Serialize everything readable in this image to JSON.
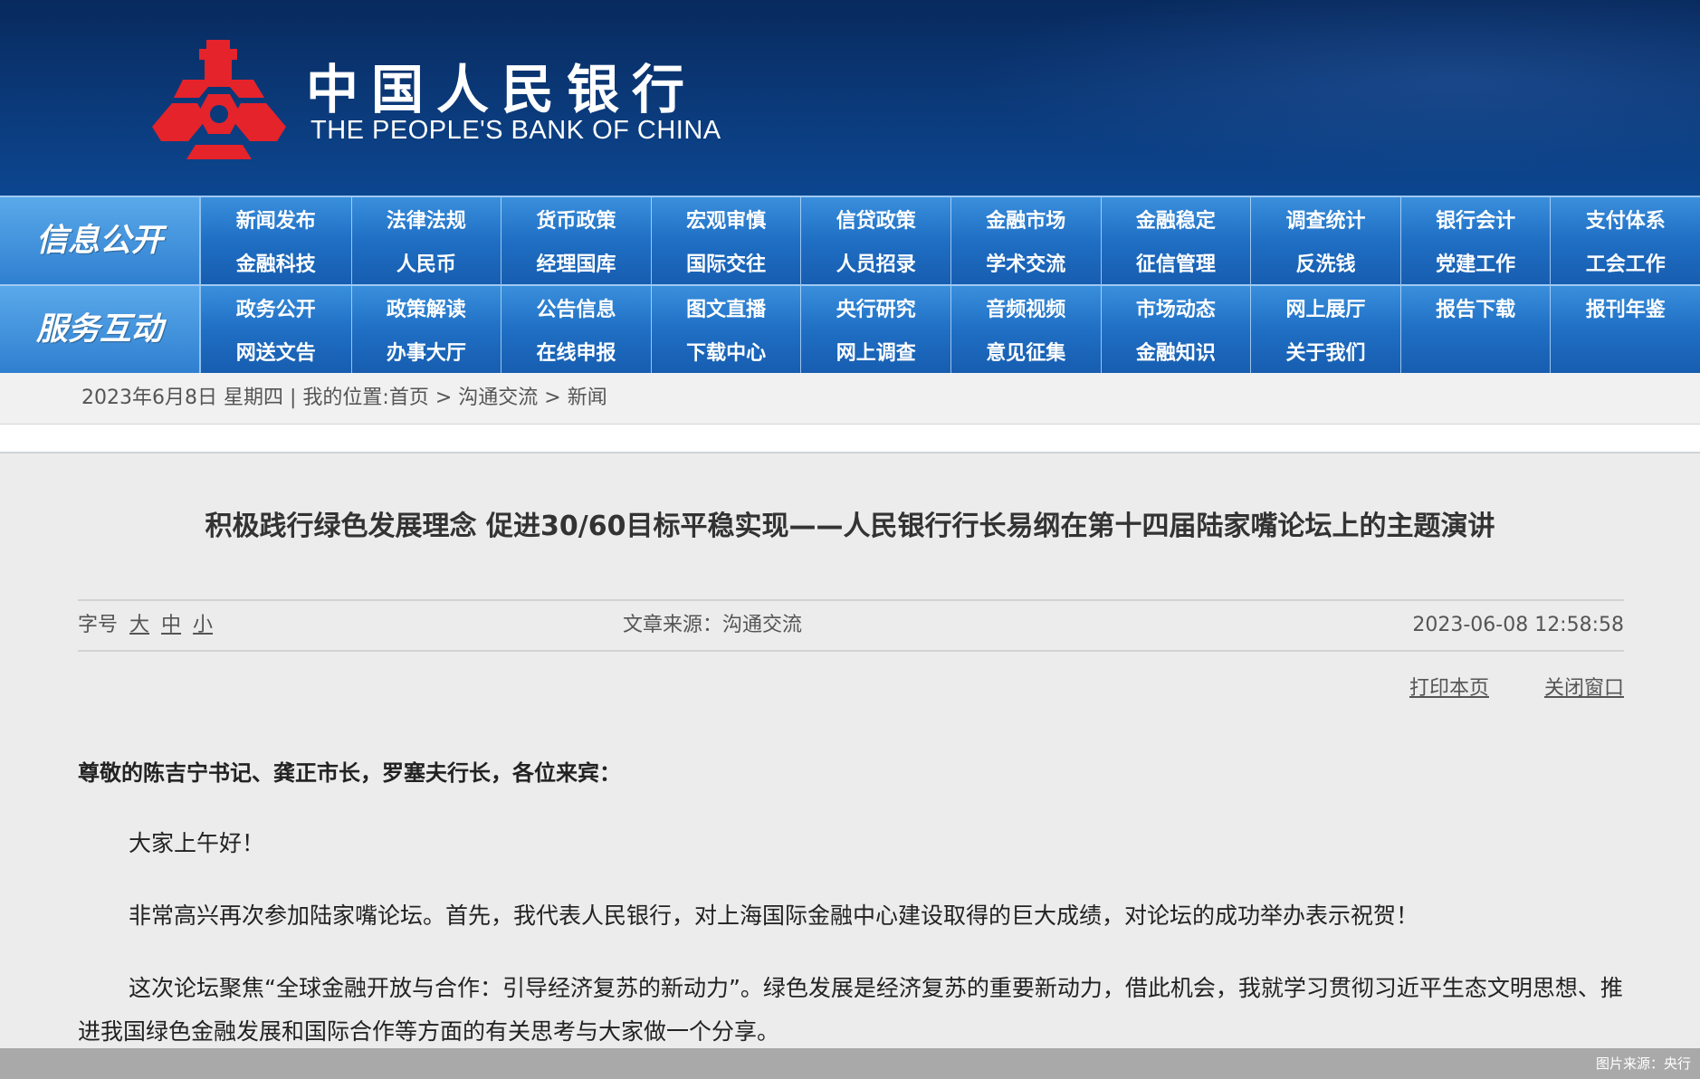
{
  "header": {
    "bank_name_cn": "中国人民银行",
    "bank_name_en": "THE PEOPLE'S BANK OF CHINA",
    "logo_icon": "pboc-emblem-icon",
    "logo_color": "#e5232b"
  },
  "nav": {
    "info": {
      "label": "信息公开",
      "row1": [
        "新闻发布",
        "法律法规",
        "货币政策",
        "宏观审慎",
        "信贷政策",
        "金融市场",
        "金融稳定",
        "调查统计",
        "银行会计",
        "支付体系"
      ],
      "row2": [
        "金融科技",
        "人民币",
        "经理国库",
        "国际交往",
        "人员招录",
        "学术交流",
        "征信管理",
        "反洗钱",
        "党建工作",
        "工会工作"
      ]
    },
    "service": {
      "label": "服务互动",
      "row1": [
        "政务公开",
        "政策解读",
        "公告信息",
        "图文直播",
        "央行研究",
        "音频视频",
        "市场动态",
        "网上展厅",
        "报告下载",
        "报刊年鉴"
      ],
      "row2": [
        "网送文告",
        "办事大厅",
        "在线申报",
        "下载中心",
        "网上调查",
        "意见征集",
        "金融知识",
        "关于我们"
      ]
    }
  },
  "breadcrumb": {
    "date": "2023年6月8日 星期四",
    "sep": "|",
    "location_label": "我的位置:",
    "home": "首页",
    "arrow": ">",
    "section": "沟通交流",
    "current": "新闻"
  },
  "article": {
    "title": "积极践行绿色发展理念 促进30/60目标平稳实现——人民银行行长易纲在第十四届陆家嘴论坛上的主题演讲",
    "font_size_label": "字号",
    "size_large": "大",
    "size_medium": "中",
    "size_small": "小",
    "source": "文章来源：沟通交流",
    "datetime": "2023-06-08 12:58:58",
    "print_label": "打印本页",
    "close_label": "关闭窗口",
    "salutation": "尊敬的陈吉宁书记、龚正市长，罗塞夫行长，各位来宾：",
    "paragraphs": [
      "大家上午好！",
      "非常高兴再次参加陆家嘴论坛。首先，我代表人民银行，对上海国际金融中心建设取得的巨大成绩，对论坛的成功举办表示祝贺！",
      "这次论坛聚焦“全球金融开放与合作：引导经济复苏的新动力”。绿色发展是经济复苏的重要新动力，借此机会，我就学习贯彻习近平生态文明思想、推进我国绿色金融发展和国际合作等方面的有关思考与大家做一个分享。"
    ]
  },
  "footer": {
    "image_credit": "图片来源：央行"
  }
}
